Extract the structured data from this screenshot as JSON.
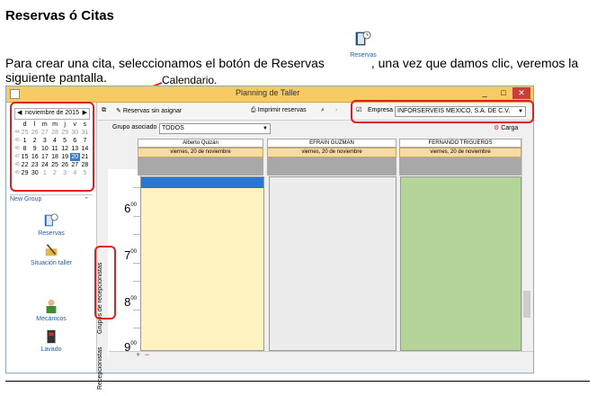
{
  "doc": {
    "title": "Reservas ó Citas",
    "para_before": "Para crear una cita, seleccionamos el botón de Reservas",
    "para_after": ", una vez que damos clic, veremos la siguiente pantalla.",
    "inline_icon_label": "Reservas",
    "callout": "Calendario."
  },
  "window": {
    "title": "Planning de Taller",
    "btn_min": "_",
    "btn_max": "□",
    "btn_close": "✕"
  },
  "calendar": {
    "month": "noviembre de 2015",
    "prev": "◀",
    "next": "▶",
    "days": [
      "d",
      "l",
      "m",
      "m",
      "j",
      "v",
      "s"
    ],
    "weeks": [
      {
        "wk": "44",
        "days": [
          "25",
          "26",
          "27",
          "28",
          "29",
          "30",
          "31"
        ]
      },
      {
        "wk": "45",
        "days": [
          "1",
          "2",
          "3",
          "4",
          "5",
          "6",
          "7"
        ]
      },
      {
        "wk": "46",
        "days": [
          "8",
          "9",
          "10",
          "11",
          "12",
          "13",
          "14"
        ]
      },
      {
        "wk": "47",
        "days": [
          "15",
          "16",
          "17",
          "18",
          "19",
          "20",
          "21"
        ]
      },
      {
        "wk": "48",
        "days": [
          "22",
          "23",
          "24",
          "25",
          "26",
          "27",
          "28"
        ]
      },
      {
        "wk": "49",
        "days": [
          "29",
          "30",
          "1",
          "2",
          "3",
          "4",
          "5"
        ]
      }
    ]
  },
  "sidebar": {
    "new_group": "New Group",
    "items": [
      {
        "label": "Reservas",
        "icon": "book-clock-icon"
      },
      {
        "label": "Situación taller",
        "icon": "tools-icon"
      },
      {
        "label": "Mecánicos",
        "icon": "mechanic-icon"
      },
      {
        "label": "Lavado",
        "icon": "washer-icon"
      }
    ]
  },
  "toolbar": {
    "unassigned": "Reservas sin asignar",
    "print": "Imprimir reservas",
    "empresa_label": "Empresa",
    "empresa_value": "INFORSERVEIS MEXICO, S.A. DE C.V.",
    "carga": "Carga"
  },
  "group": {
    "label": "Grupo asociado",
    "value": "TODOS"
  },
  "tabs": {
    "recepcionistas": "Recepcionistas",
    "grupos": "Grupos de recepcionistas"
  },
  "hours": [
    {
      "h": "6",
      "m": "00"
    },
    {
      "h": "7",
      "m": "00"
    },
    {
      "h": "8",
      "m": "00"
    },
    {
      "h": "9",
      "m": "00"
    }
  ],
  "columns": [
    {
      "name": "Alberto Quizán",
      "day": "viernes, 20 de noviembre",
      "color": "#fdf2c0"
    },
    {
      "name": "EFRAIN GUZMAN",
      "day": "viernes, 20 de noviembre",
      "color": "#ececec"
    },
    {
      "name": "FERNANDO TRIGUEROS",
      "day": "viernes, 20 de noviembre",
      "color": "#b4d49a"
    }
  ],
  "footer": {
    "plus": "+",
    "minus": "−"
  }
}
